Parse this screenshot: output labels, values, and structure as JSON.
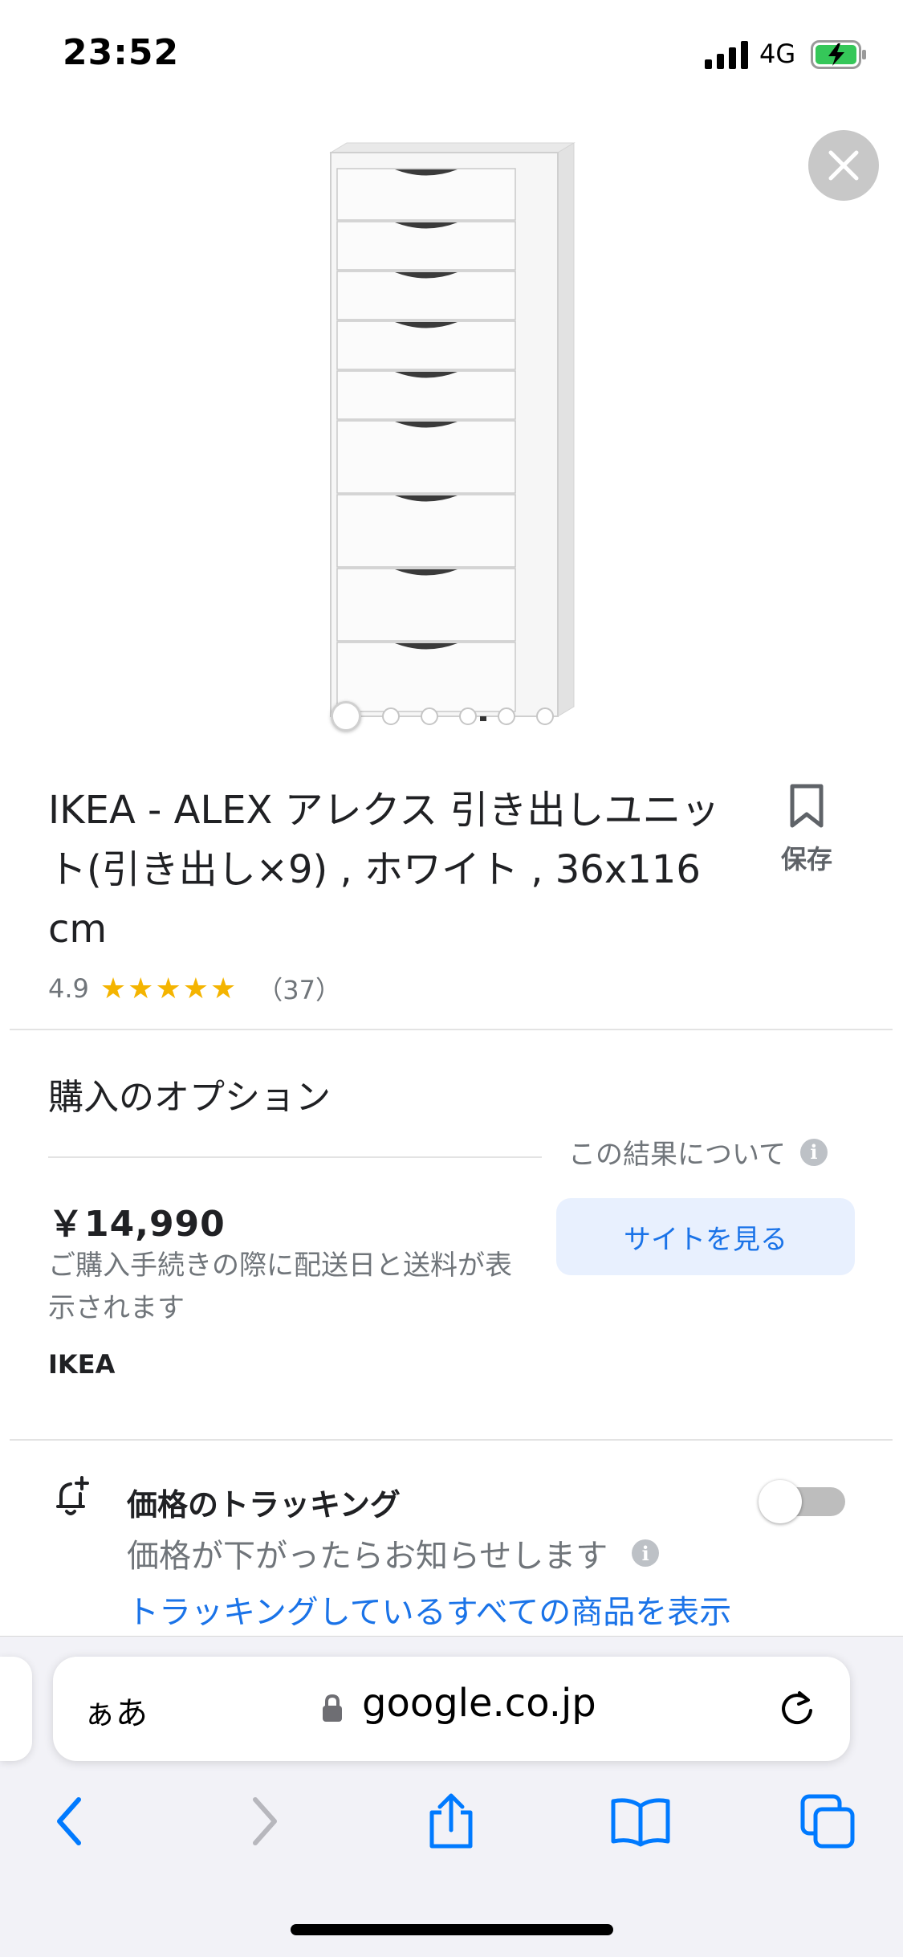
{
  "status_bar": {
    "time": "23:52",
    "network": "4G"
  },
  "carousel": {
    "count": 6,
    "active": 0
  },
  "product": {
    "title": "IKEA - ALEX アレクス 引き出しユニット(引き出し×9) , ホワイト , 36x116 cm",
    "save_label": "保存",
    "rating": "4.9",
    "stars": "★★★★★",
    "review_count": "（37）"
  },
  "purchase": {
    "heading": "購入のオプション",
    "about_label": "この結果について",
    "price": "￥14,990",
    "note": "ご購入手続きの際に配送日と送料が表示されます",
    "seller": "IKEA",
    "visit_button": "サイトを見る"
  },
  "tracking": {
    "title": "価格のトラッキング",
    "subtitle": "価格が下がったらお知らせします",
    "link": "トラッキングしているすべての商品を表示",
    "enabled": false
  },
  "browser": {
    "aa_label": "ぁあ",
    "url": "google.co.jp"
  },
  "icons": [
    "close-icon",
    "bookmark-icon",
    "info-icon",
    "bell-plus-icon",
    "lock-icon",
    "reload-icon",
    "back-icon",
    "forward-icon",
    "share-icon",
    "bookmarks-icon",
    "tabs-icon"
  ]
}
